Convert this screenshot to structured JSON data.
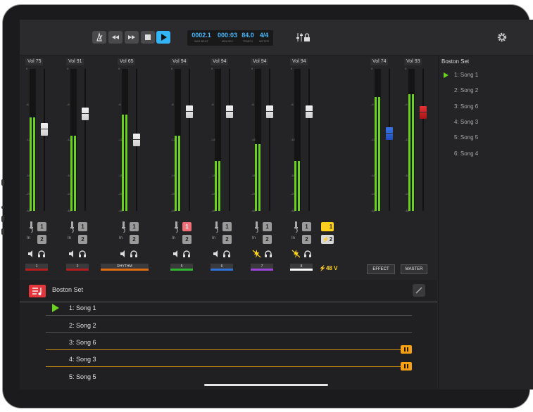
{
  "transport": {
    "bar_beat": "0002.1",
    "bar_beat_label": "BAR.BEAT",
    "min_sec": "000:03",
    "min_sec_label": "MIN:SEC",
    "tempo": "84.0",
    "tempo_label": "TEMPO",
    "meter": "4/4",
    "meter_label": "METER"
  },
  "channels": [
    {
      "vol_label": "Vol",
      "vol": "75",
      "level": 0.66,
      "fader": 0.58,
      "label": "1",
      "color": "#b31d1d",
      "active_in": false
    },
    {
      "vol_label": "Vol",
      "vol": "91",
      "level": 0.53,
      "fader": 0.7,
      "label": "2",
      "color": "#b31d1d",
      "active_in": false
    },
    {
      "vol_label": "Vol",
      "vol": "65",
      "level": 0.68,
      "fader": 0.5,
      "label": "RHYTHM",
      "color": "#e06d0f",
      "active_in": false
    },
    {
      "vol_label": "Vol",
      "vol": "94",
      "level": 0.53,
      "fader": 0.72,
      "label": "5",
      "color": "#2fb52f",
      "active_in": true
    },
    {
      "vol_label": "Vol",
      "vol": "94",
      "level": 0.35,
      "fader": 0.72,
      "label": "6",
      "color": "#2e73d8",
      "active_in": false
    },
    {
      "vol_label": "Vol",
      "vol": "94",
      "level": 0.47,
      "fader": 0.72,
      "label": "7",
      "color": "#9a46d8",
      "active_in": false
    },
    {
      "vol_label": "Vol",
      "vol": "94",
      "level": 0.35,
      "fader": 0.72,
      "label": "8",
      "color": "#ffffff",
      "active_in": false
    }
  ],
  "effect": {
    "vol_label": "Vol",
    "vol": "74",
    "level": 0.8,
    "fader": 0.55,
    "button": "EFFECT"
  },
  "master": {
    "vol_label": "Vol",
    "vol": "93",
    "level": 0.82,
    "fader": 0.71,
    "button": "MASTER"
  },
  "phantom": {
    "btn1": "1",
    "btn2": "2",
    "voltage": "48 V"
  },
  "scale_ticks": [
    "0",
    "-6",
    "-12",
    "-18",
    "-24",
    "-48"
  ],
  "input_label": "In",
  "input_buttons": [
    "1",
    "2"
  ],
  "setlist": {
    "title": "Boston Set",
    "songs": [
      "1: Song 1",
      "2: Song 2",
      "3: Song 6",
      "4: Song 3",
      "5: Song 5"
    ]
  },
  "sidebar": {
    "title": "Boston Set",
    "songs": [
      "1: Song 1",
      "2: Song 2",
      "3: Song 6",
      "4: Song 3",
      "5: Song 5",
      "6: Song 4"
    ]
  },
  "colors": {
    "meter": "#6ad11f",
    "accent": "#46b8ff",
    "play": "#35b4f5",
    "warning": "#ffd21a",
    "marker": "#f7a10e"
  },
  "icons": [
    "metronome-icon",
    "rewind-icon",
    "fast-forward-icon",
    "stop-icon",
    "play-icon",
    "mixer-lock-icon",
    "gear-icon",
    "setlist-icon",
    "pencil-icon",
    "jack-icon",
    "speaker-icon",
    "headphones-icon",
    "lightning-icon"
  ]
}
